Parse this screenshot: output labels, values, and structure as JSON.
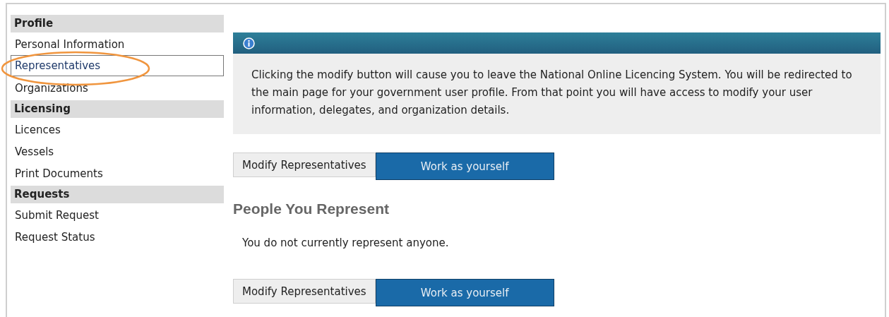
{
  "sidebar": {
    "sections": [
      {
        "title": "Profile",
        "items": [
          {
            "label": "Personal Information",
            "selected": false
          },
          {
            "label": "Representatives",
            "selected": true
          },
          {
            "label": "Organizations",
            "selected": false
          }
        ]
      },
      {
        "title": "Licensing",
        "items": [
          {
            "label": "Licences",
            "selected": false
          },
          {
            "label": "Vessels",
            "selected": false
          },
          {
            "label": "Print Documents",
            "selected": false
          }
        ]
      },
      {
        "title": "Requests",
        "items": [
          {
            "label": "Submit Request",
            "selected": false
          },
          {
            "label": "Request Status",
            "selected": false
          }
        ]
      }
    ]
  },
  "info_box": {
    "message": "Clicking the modify button will cause you to leave the National Online Licencing System. You will be redirected to the main page for your government user profile. From that point you will have access to modify your user information, delegates, and organization details."
  },
  "button_rows": [
    {
      "buttons": [
        {
          "label": "Modify Representatives",
          "kind": "secondary"
        },
        {
          "label": "Work as yourself",
          "kind": "primary"
        }
      ]
    },
    {
      "buttons": [
        {
          "label": "Modify Representatives",
          "kind": "secondary"
        },
        {
          "label": "Work as yourself",
          "kind": "primary"
        }
      ]
    }
  ],
  "section": {
    "heading": "People You Represent",
    "message": "You do not currently represent anyone."
  }
}
